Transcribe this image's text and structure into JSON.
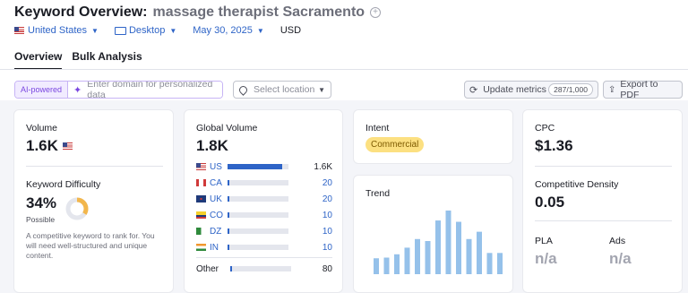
{
  "header": {
    "title": "Keyword Overview:",
    "keyword": "massage therapist Sacramento",
    "filters": {
      "country": "United States",
      "device": "Desktop",
      "date": "May 30, 2025",
      "currency": "USD"
    }
  },
  "tabs": [
    {
      "label": "Overview",
      "active": true
    },
    {
      "label": "Bulk Analysis",
      "active": false
    }
  ],
  "toolbar": {
    "ai_badge": "AI-powered",
    "domain_placeholder": "Enter domain for personalized data",
    "location_placeholder": "Select location",
    "update_label": "Update metrics",
    "update_counter": "287/1,000",
    "export_label": "Export to PDF"
  },
  "volume_card": {
    "label": "Volume",
    "value": "1.6K",
    "kd_label": "Keyword Difficulty",
    "kd_value": "34%",
    "kd_level": "Possible",
    "kd_percent": 34,
    "kd_description": "A competitive keyword to rank for. You will need well-structured and unique content.",
    "kd_color": "#f2b64c"
  },
  "global_card": {
    "label": "Global Volume",
    "value": "1.8K",
    "countries": [
      {
        "code": "US",
        "value": "1.6K",
        "share": 0.89,
        "link": false
      },
      {
        "code": "CA",
        "value": "20",
        "share": 0.02,
        "link": true
      },
      {
        "code": "UK",
        "value": "20",
        "share": 0.02,
        "link": true
      },
      {
        "code": "CO",
        "value": "10",
        "share": 0.01,
        "link": true
      },
      {
        "code": "DZ",
        "value": "10",
        "share": 0.01,
        "link": true
      },
      {
        "code": "IN",
        "value": "10",
        "share": 0.01,
        "link": true
      }
    ],
    "other_label": "Other",
    "other_value": "80"
  },
  "intent_card": {
    "label": "Intent",
    "badge": "Commercial"
  },
  "trend_card": {
    "label": "Trend",
    "values": [
      0.24,
      0.25,
      0.3,
      0.4,
      0.53,
      0.5,
      0.81,
      0.96,
      0.79,
      0.53,
      0.64,
      0.32,
      0.32
    ],
    "color": "#95c1ea"
  },
  "cpc_card": {
    "cpc_label": "CPC",
    "cpc_value": "$1.36",
    "cd_label": "Competitive Density",
    "cd_value": "0.05",
    "pla_label": "PLA",
    "pla_value": "n/a",
    "ads_label": "Ads",
    "ads_value": "n/a"
  },
  "colors": {
    "link": "#2e64c7",
    "bar": "#2e64c7",
    "ai": "#7a46e0"
  }
}
